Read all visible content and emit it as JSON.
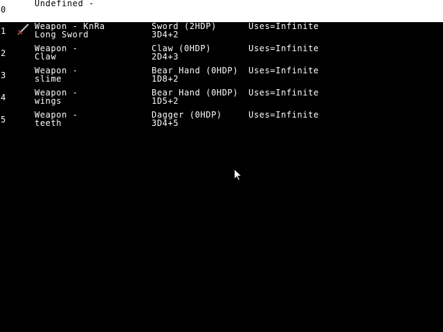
{
  "selected": {
    "index": "0",
    "category": "Undefined -"
  },
  "items": [
    {
      "index": "1",
      "category": "Weapon - KnRa",
      "name": "Long Sword",
      "type": "Sword (2HDP)",
      "damage": "3D4+2",
      "uses": "Uses=Infinite",
      "icon": "sword-icon"
    },
    {
      "index": "2",
      "category": "Weapon -",
      "name": "Claw",
      "type": "Claw (0HDP)",
      "damage": "2D4+3",
      "uses": "Uses=Infinite"
    },
    {
      "index": "3",
      "category": "Weapon -",
      "name": "slime",
      "type": "Bear Hand (0HDP)",
      "damage": "1D8+2",
      "uses": "Uses=Infinite"
    },
    {
      "index": "4",
      "category": "Weapon -",
      "name": "wings",
      "type": "Bear Hand (0HDP)",
      "damage": "1D5+2",
      "uses": "Uses=Infinite"
    },
    {
      "index": "5",
      "category": "Weapon -",
      "name": "teeth",
      "type": "Dagger (0HDP)",
      "damage": "3D4+5",
      "uses": "Uses=Infinite"
    }
  ],
  "colors": {
    "background": "#000000",
    "text": "#ffffff",
    "selected_background": "#ffffff",
    "selected_text": "#000000"
  },
  "cursor": "arrow-cursor-icon"
}
